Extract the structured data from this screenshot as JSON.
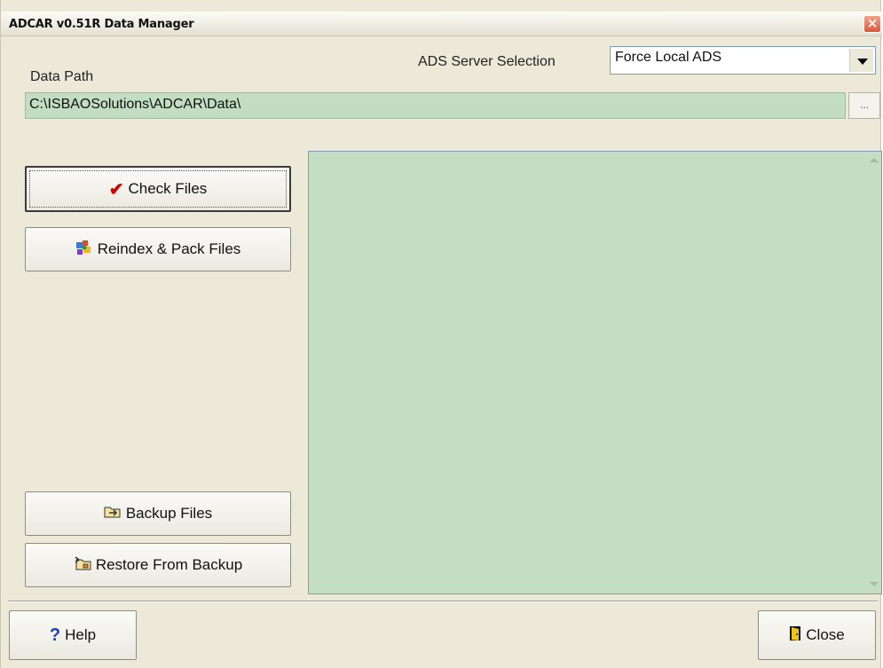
{
  "window": {
    "title": "ADCAR v0.51R Data Manager",
    "close_glyph": "×"
  },
  "server": {
    "label": "ADS Server Selection",
    "selected": "Force Local ADS"
  },
  "data_path": {
    "label": "Data Path",
    "value": "C:\\ISBAOSolutions\\ADCAR\\Data\\",
    "browse_label": "..."
  },
  "buttons": {
    "check_files": "Check Files",
    "reindex": "Reindex & Pack Files",
    "backup": "Backup Files",
    "restore": "Restore From Backup",
    "help": "Help",
    "close": "Close"
  },
  "icons": {
    "check": "✔",
    "reindex": "gear-puzzle",
    "backup": "folder-backup",
    "restore": "folder-restore",
    "help": "?",
    "close": "door-exit"
  },
  "colors": {
    "field_bg": "#c2ddc1",
    "window_bg": "#ece9d8",
    "check_accent": "#d40000",
    "help_accent": "#1d3fb8"
  }
}
